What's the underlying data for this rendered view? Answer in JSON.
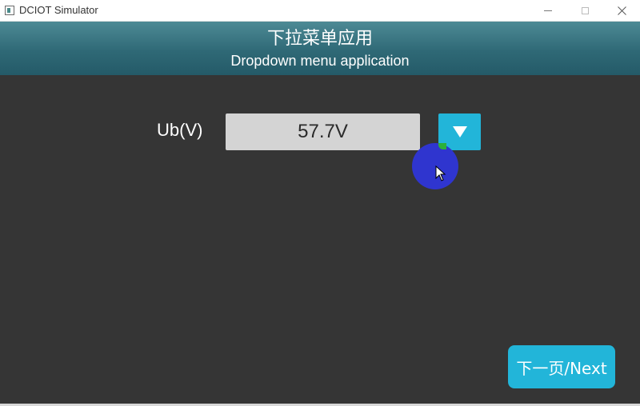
{
  "window": {
    "title": "DCIOT Simulator",
    "icons": [
      "app-icon",
      "minimize-icon",
      "maximize-icon",
      "close-icon"
    ]
  },
  "header": {
    "title_cn": "下拉菜单应用",
    "title_en": "Dropdown menu application"
  },
  "field": {
    "label": "Ub(V)",
    "value": "57.7V",
    "dropdown_icon": "triangle-down-icon"
  },
  "footer": {
    "next_label": "下一页/Next"
  },
  "colors": {
    "background": "#353535",
    "header": "#2f6976",
    "accent": "#22b5d9",
    "value_box": "#d4d4d4",
    "touch_indicator": "#2f35cf"
  }
}
